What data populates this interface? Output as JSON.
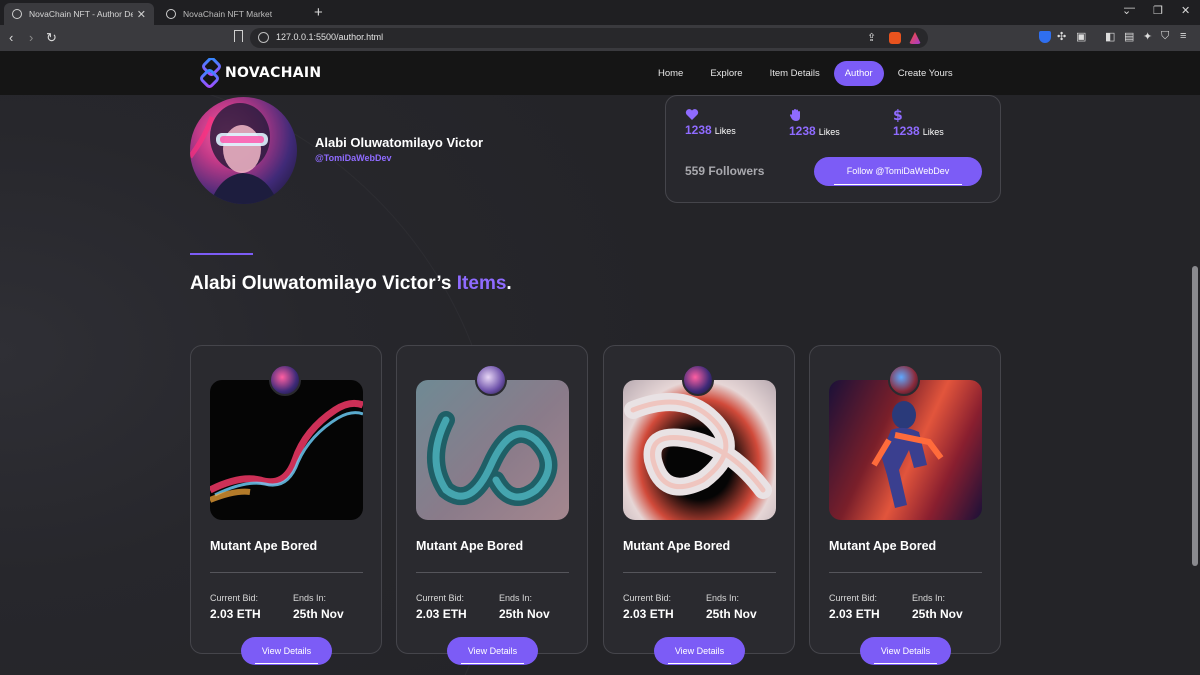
{
  "browser": {
    "tabs": [
      {
        "title": "NovaChain NFT - Author Detail P",
        "active": true
      },
      {
        "title": "NovaChain NFT Market",
        "active": false
      }
    ],
    "url": "127.0.0.1:5500/author.html"
  },
  "nav": {
    "brand": "NOVACHAIN",
    "items": [
      {
        "label": "Home",
        "active": false
      },
      {
        "label": "Explore",
        "active": false
      },
      {
        "label": "Item Details",
        "active": false
      },
      {
        "label": "Author",
        "active": true
      },
      {
        "label": "Create Yours",
        "active": false
      }
    ]
  },
  "author": {
    "name": "Alabi Oluwatomilayo Victor",
    "handle": "@TomiDaWebDev"
  },
  "stats": {
    "items": [
      {
        "icon": "heart-icon",
        "value": "1238",
        "label": "Likes"
      },
      {
        "icon": "hand-icon",
        "value": "1238",
        "label": "Likes"
      },
      {
        "icon": "dollar-icon",
        "value": "1238",
        "label": "Likes"
      }
    ],
    "followers": "559 Followers",
    "follow_button": "Follow @TomiDaWebDev"
  },
  "section": {
    "title_prefix": "Alabi Oluwatomilayo Victor’s",
    "title_accent": "Items",
    "title_suffix": "."
  },
  "cards": [
    {
      "title": "Mutant Ape Bored",
      "bid_label": "Current Bid:",
      "bid_value": "2.03 ETH",
      "ends_label": "Ends In:",
      "ends_value": "25th Nov",
      "button": "View Details"
    },
    {
      "title": "Mutant Ape Bored",
      "bid_label": "Current Bid:",
      "bid_value": "2.03 ETH",
      "ends_label": "Ends In:",
      "ends_value": "25th Nov",
      "button": "View Details"
    },
    {
      "title": "Mutant Ape Bored",
      "bid_label": "Current Bid:",
      "bid_value": "2.03 ETH",
      "ends_label": "Ends In:",
      "ends_value": "25th Nov",
      "button": "View Details"
    },
    {
      "title": "Mutant Ape Bored",
      "bid_label": "Current Bid:",
      "bid_value": "2.03 ETH",
      "ends_label": "Ends In:",
      "ends_value": "25th Nov",
      "button": "View Details"
    }
  ],
  "colors": {
    "accent": "#7c5cf6",
    "accent_text": "#8f6bff",
    "nav_bg": "#151515",
    "page_bg": "#27272c",
    "card_bg": "#2a2a2f"
  }
}
